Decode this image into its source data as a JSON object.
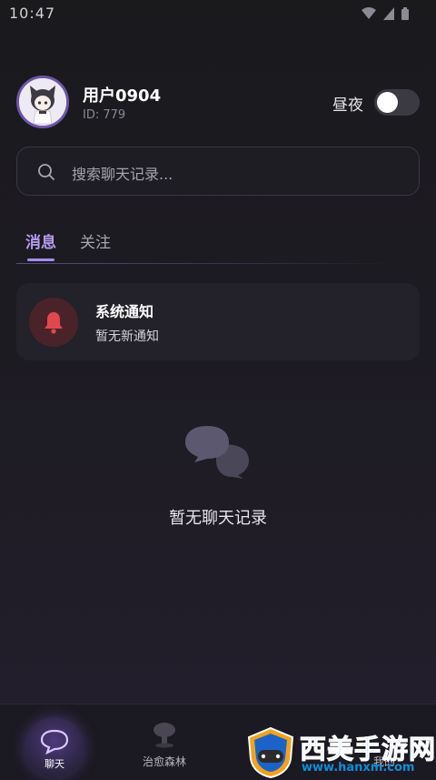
{
  "status_bar": {
    "time": "10:47"
  },
  "profile": {
    "username": "用户0904",
    "id_text": "ID: 779"
  },
  "day_night": {
    "label": "昼夜",
    "enabled": false
  },
  "search": {
    "placeholder": "搜索聊天记录..."
  },
  "tabs": [
    {
      "label": "消息",
      "active": true
    },
    {
      "label": "关注",
      "active": false
    }
  ],
  "notification": {
    "title": "系统通知",
    "subtitle": "暂无新通知",
    "icon": "bell-icon"
  },
  "empty_state": {
    "text": "暂无聊天记录",
    "icon": "chat-bubbles-icon"
  },
  "bottom_nav": [
    {
      "label": "聊天",
      "icon": "chat-icon",
      "active": true
    },
    {
      "label": "治愈森林",
      "icon": "tree-icon",
      "active": false
    },
    {
      "label": "我的",
      "icon": "profile-icon",
      "active": false
    }
  ],
  "watermark": {
    "title": "西美手游网",
    "url": "www.hanxm.com"
  },
  "colors": {
    "accent": "#b59bf0",
    "bell": "#e0484f",
    "background": "#1a1a1d"
  }
}
